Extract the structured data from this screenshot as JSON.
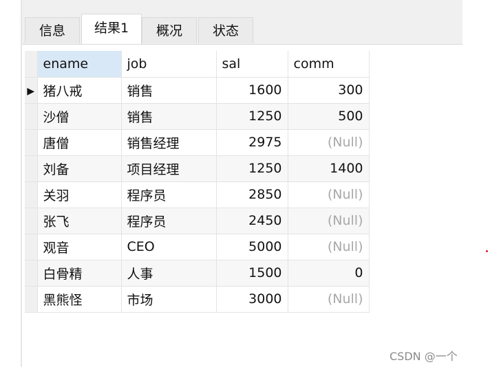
{
  "tabs": [
    {
      "label": "信息"
    },
    {
      "label": "结果1"
    },
    {
      "label": "概况"
    },
    {
      "label": "状态"
    }
  ],
  "table": {
    "columns": [
      "ename",
      "job",
      "sal",
      "comm"
    ],
    "current_row_marker": "▶",
    "rows": [
      {
        "ename": "猪八戒",
        "job": "销售",
        "sal": "1600",
        "comm": "300"
      },
      {
        "ename": "沙僧",
        "job": "销售",
        "sal": "1250",
        "comm": "500"
      },
      {
        "ename": "唐僧",
        "job": "销售经理",
        "sal": "2975",
        "comm": "(Null)"
      },
      {
        "ename": "刘备",
        "job": "项目经理",
        "sal": "1250",
        "comm": "1400"
      },
      {
        "ename": "关羽",
        "job": "程序员",
        "sal": "2850",
        "comm": "(Null)"
      },
      {
        "ename": "张飞",
        "job": "程序员",
        "sal": "2450",
        "comm": "(Null)"
      },
      {
        "ename": "观音",
        "job": "CEO",
        "sal": "5000",
        "comm": "(Null)"
      },
      {
        "ename": "白骨精",
        "job": "人事",
        "sal": "1500",
        "comm": "0"
      },
      {
        "ename": "黑熊怪",
        "job": "市场",
        "sal": "3000",
        "comm": "(Null)"
      }
    ]
  },
  "watermark": "CSDN @一个",
  "colors": {
    "null_text": "#a8a8a8",
    "sorted_header": "#d9e8f6",
    "accent_dot": "#e02020"
  }
}
